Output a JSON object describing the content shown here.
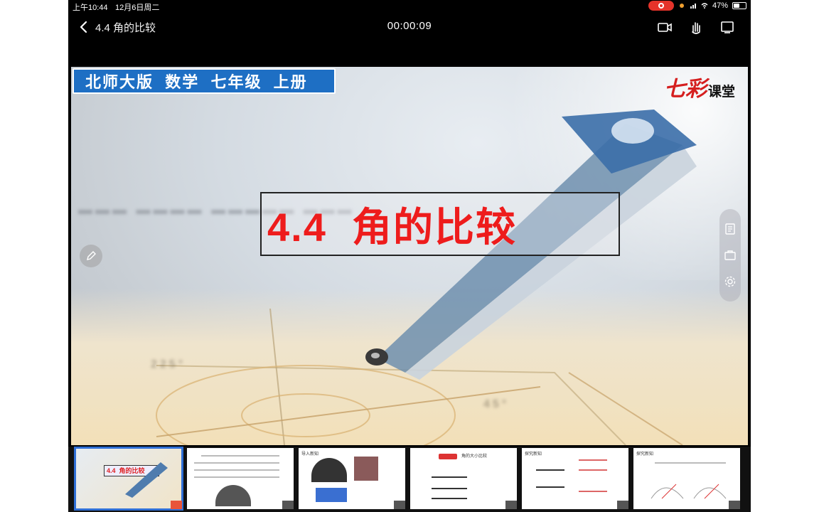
{
  "status_bar": {
    "time": "上午10:44",
    "date": "12月6日周二",
    "battery": "47%",
    "battery_level": 0.47
  },
  "nav": {
    "title": "4.4 角的比较",
    "timer": "00:00:09",
    "icons": [
      "back-chevron-icon",
      "screen-record-icon",
      "hand-raise-icon",
      "fullscreen-icon"
    ]
  },
  "slide": {
    "publisher_banner": "北师大版  数学  七年级  上册",
    "brand_red": "七彩",
    "brand_black": "课堂",
    "title": "4.4  角的比较",
    "background_angle_labels": [
      "225°",
      "45°"
    ],
    "colors": {
      "banner": "#1e6fc4",
      "title": "#ee1c1c",
      "brand": "#d51f1f"
    }
  },
  "side_toolbar": {
    "icons": [
      "notes-icon",
      "briefcase-icon",
      "settings-icon"
    ]
  },
  "thumbnails": [
    {
      "label": "4.4  角的比较",
      "active": true
    },
    {
      "label": "",
      "active": false
    },
    {
      "label": "导入新知",
      "active": false
    },
    {
      "label": "角的大小比较",
      "active": false
    },
    {
      "label": "探究新知",
      "active": false
    },
    {
      "label": "探究新知",
      "active": false
    }
  ]
}
